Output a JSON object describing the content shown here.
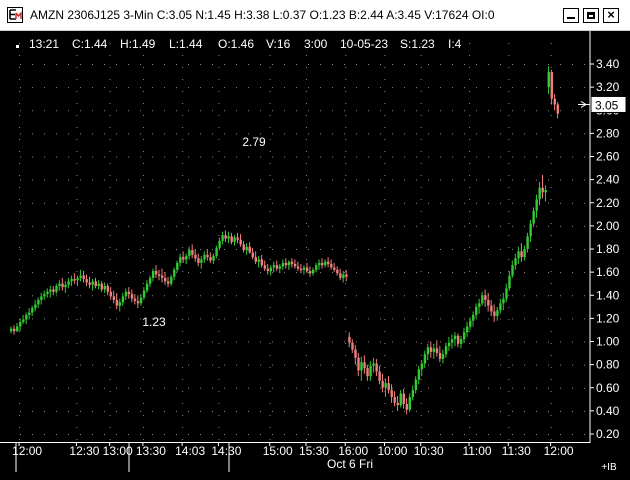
{
  "window": {
    "title": "AMZN 2306J125 3-Min C:3.05 N:1.45 H:3.38 L:0.37 O:1.23 B:2.44 A:3.45 V:17624 OI:0",
    "close_glyph": "×"
  },
  "info_bar": [
    "13:21",
    "C:1.44",
    "H:1.49",
    "L:1.44",
    "O:1.46",
    "V:16",
    "3:00",
    "10-05-23",
    "S:1.23",
    "I:4"
  ],
  "annotations": {
    "high_label": "2.79",
    "low_label": "1.23"
  },
  "colors": {
    "up": "#33cc33",
    "down": "#f08080",
    "background": "#000000",
    "text": "#ffffff",
    "grid_dot": "#8a8a8a"
  },
  "chart_data": {
    "type": "candlestick",
    "symbol": "AMZN 2306J125",
    "interval": "3-Min",
    "current_price_label": "3.05",
    "current_price": 3.05,
    "ylim": [
      0.18,
      3.52
    ],
    "y_ticks": [
      "3.40",
      "3.20",
      "3.00",
      "2.80",
      "2.60",
      "2.40",
      "2.20",
      "2.00",
      "1.80",
      "1.60",
      "1.40",
      "1.20",
      "1.00",
      "0.80",
      "0.60",
      "0.40",
      "0.20"
    ],
    "x_ticks": [
      "12:00",
      "12:30",
      "13:00",
      "13:30",
      "14:03",
      "14:30",
      "15:00",
      "15:30",
      "16:00",
      "10:00",
      "10:30",
      "11:00",
      "11:30",
      "12:00"
    ],
    "x_ticks_bar_index": [
      3,
      22,
      33,
      44,
      57,
      69,
      86,
      98,
      111,
      124,
      136,
      152,
      165,
      179
    ],
    "session_label": "Oct 6 Fri",
    "corner_label": "+IB",
    "ohlc": [
      [
        1.09,
        1.13,
        1.07,
        1.11
      ],
      [
        1.11,
        1.14,
        1.06,
        1.09
      ],
      [
        1.09,
        1.16,
        1.08,
        1.13
      ],
      [
        1.13,
        1.19,
        1.09,
        1.17
      ],
      [
        1.17,
        1.23,
        1.15,
        1.19
      ],
      [
        1.19,
        1.25,
        1.15,
        1.23
      ],
      [
        1.23,
        1.29,
        1.19,
        1.25
      ],
      [
        1.25,
        1.31,
        1.22,
        1.29
      ],
      [
        1.29,
        1.36,
        1.26,
        1.32
      ],
      [
        1.32,
        1.38,
        1.29,
        1.36
      ],
      [
        1.36,
        1.42,
        1.32,
        1.39
      ],
      [
        1.39,
        1.44,
        1.36,
        1.41
      ],
      [
        1.41,
        1.46,
        1.38,
        1.43
      ],
      [
        1.43,
        1.48,
        1.38,
        1.45
      ],
      [
        1.45,
        1.48,
        1.4,
        1.43
      ],
      [
        1.43,
        1.5,
        1.41,
        1.48
      ],
      [
        1.48,
        1.53,
        1.44,
        1.5
      ],
      [
        1.5,
        1.55,
        1.44,
        1.47
      ],
      [
        1.47,
        1.52,
        1.42,
        1.49
      ],
      [
        1.49,
        1.55,
        1.46,
        1.52
      ],
      [
        1.52,
        1.57,
        1.48,
        1.54
      ],
      [
        1.54,
        1.59,
        1.5,
        1.53
      ],
      [
        1.53,
        1.57,
        1.48,
        1.55
      ],
      [
        1.55,
        1.62,
        1.52,
        1.57
      ],
      [
        1.57,
        1.61,
        1.51,
        1.54
      ],
      [
        1.54,
        1.58,
        1.48,
        1.51
      ],
      [
        1.51,
        1.56,
        1.46,
        1.49
      ],
      [
        1.49,
        1.54,
        1.44,
        1.52
      ],
      [
        1.52,
        1.55,
        1.46,
        1.48
      ],
      [
        1.48,
        1.53,
        1.45,
        1.5
      ],
      [
        1.5,
        1.52,
        1.43,
        1.45
      ],
      [
        1.45,
        1.51,
        1.42,
        1.48
      ],
      [
        1.48,
        1.5,
        1.4,
        1.43
      ],
      [
        1.43,
        1.47,
        1.36,
        1.39
      ],
      [
        1.39,
        1.44,
        1.33,
        1.36
      ],
      [
        1.36,
        1.42,
        1.28,
        1.31
      ],
      [
        1.31,
        1.37,
        1.26,
        1.34
      ],
      [
        1.34,
        1.42,
        1.31,
        1.39
      ],
      [
        1.39,
        1.46,
        1.36,
        1.43
      ],
      [
        1.43,
        1.47,
        1.37,
        1.41
      ],
      [
        1.41,
        1.45,
        1.34,
        1.37
      ],
      [
        1.37,
        1.41,
        1.32,
        1.35
      ],
      [
        1.35,
        1.4,
        1.29,
        1.33
      ],
      [
        1.33,
        1.41,
        1.31,
        1.38
      ],
      [
        1.38,
        1.47,
        1.36,
        1.44
      ],
      [
        1.44,
        1.53,
        1.42,
        1.5
      ],
      [
        1.5,
        1.57,
        1.47,
        1.55
      ],
      [
        1.55,
        1.63,
        1.52,
        1.61
      ],
      [
        1.61,
        1.66,
        1.55,
        1.58
      ],
      [
        1.58,
        1.62,
        1.53,
        1.57
      ],
      [
        1.57,
        1.63,
        1.51,
        1.55
      ],
      [
        1.55,
        1.6,
        1.49,
        1.52
      ],
      [
        1.52,
        1.56,
        1.47,
        1.5
      ],
      [
        1.5,
        1.58,
        1.48,
        1.56
      ],
      [
        1.56,
        1.64,
        1.53,
        1.62
      ],
      [
        1.62,
        1.7,
        1.6,
        1.68
      ],
      [
        1.68,
        1.76,
        1.65,
        1.73
      ],
      [
        1.73,
        1.78,
        1.68,
        1.71
      ],
      [
        1.71,
        1.76,
        1.67,
        1.74
      ],
      [
        1.74,
        1.82,
        1.71,
        1.79
      ],
      [
        1.79,
        1.84,
        1.72,
        1.75
      ],
      [
        1.75,
        1.8,
        1.69,
        1.72
      ],
      [
        1.72,
        1.76,
        1.65,
        1.68
      ],
      [
        1.68,
        1.74,
        1.63,
        1.71
      ],
      [
        1.71,
        1.78,
        1.68,
        1.75
      ],
      [
        1.75,
        1.8,
        1.7,
        1.73
      ],
      [
        1.73,
        1.77,
        1.68,
        1.7
      ],
      [
        1.7,
        1.76,
        1.67,
        1.74
      ],
      [
        1.74,
        1.83,
        1.72,
        1.81
      ],
      [
        1.81,
        1.9,
        1.79,
        1.87
      ],
      [
        1.87,
        1.95,
        1.84,
        1.92
      ],
      [
        1.92,
        1.96,
        1.86,
        1.89
      ],
      [
        1.89,
        1.95,
        1.85,
        1.91
      ],
      [
        1.91,
        1.94,
        1.84,
        1.86
      ],
      [
        1.86,
        1.92,
        1.83,
        1.9
      ],
      [
        1.9,
        1.94,
        1.85,
        1.88
      ],
      [
        1.88,
        1.93,
        1.82,
        1.84
      ],
      [
        1.84,
        1.87,
        1.77,
        1.79
      ],
      [
        1.79,
        1.85,
        1.75,
        1.82
      ],
      [
        1.82,
        1.86,
        1.76,
        1.77
      ],
      [
        1.77,
        1.81,
        1.71,
        1.73
      ],
      [
        1.73,
        1.78,
        1.67,
        1.69
      ],
      [
        1.69,
        1.74,
        1.64,
        1.71
      ],
      [
        1.71,
        1.75,
        1.64,
        1.66
      ],
      [
        1.66,
        1.7,
        1.61,
        1.63
      ],
      [
        1.63,
        1.67,
        1.58,
        1.61
      ],
      [
        1.61,
        1.66,
        1.57,
        1.64
      ],
      [
        1.64,
        1.69,
        1.6,
        1.66
      ],
      [
        1.66,
        1.7,
        1.61,
        1.63
      ],
      [
        1.63,
        1.67,
        1.59,
        1.65
      ],
      [
        1.65,
        1.71,
        1.62,
        1.68
      ],
      [
        1.68,
        1.72,
        1.63,
        1.66
      ],
      [
        1.66,
        1.7,
        1.62,
        1.69
      ],
      [
        1.69,
        1.72,
        1.64,
        1.67
      ],
      [
        1.67,
        1.71,
        1.63,
        1.65
      ],
      [
        1.65,
        1.69,
        1.61,
        1.63
      ],
      [
        1.63,
        1.67,
        1.59,
        1.62
      ],
      [
        1.62,
        1.66,
        1.58,
        1.64
      ],
      [
        1.64,
        1.68,
        1.59,
        1.61
      ],
      [
        1.61,
        1.65,
        1.56,
        1.59
      ],
      [
        1.59,
        1.64,
        1.57,
        1.62
      ],
      [
        1.62,
        1.68,
        1.6,
        1.66
      ],
      [
        1.66,
        1.71,
        1.62,
        1.68
      ],
      [
        1.68,
        1.72,
        1.63,
        1.66
      ],
      [
        1.66,
        1.71,
        1.64,
        1.69
      ],
      [
        1.69,
        1.73,
        1.64,
        1.67
      ],
      [
        1.67,
        1.71,
        1.62,
        1.64
      ],
      [
        1.64,
        1.68,
        1.6,
        1.62
      ],
      [
        1.62,
        1.65,
        1.57,
        1.59
      ],
      [
        1.59,
        1.63,
        1.53,
        1.55
      ],
      [
        1.55,
        1.61,
        1.51,
        1.58
      ],
      [
        1.58,
        1.62,
        1.52,
        1.56
      ],
      [
        1.04,
        1.08,
        0.95,
        0.99
      ],
      [
        0.99,
        1.02,
        0.9,
        0.93
      ],
      [
        0.93,
        0.97,
        0.8,
        0.86
      ],
      [
        0.86,
        0.9,
        0.7,
        0.75
      ],
      [
        0.75,
        0.87,
        0.66,
        0.82
      ],
      [
        0.82,
        0.88,
        0.72,
        0.77
      ],
      [
        0.77,
        0.8,
        0.66,
        0.7
      ],
      [
        0.7,
        0.83,
        0.66,
        0.79
      ],
      [
        0.79,
        0.86,
        0.73,
        0.81
      ],
      [
        0.81,
        0.85,
        0.7,
        0.74
      ],
      [
        0.74,
        0.79,
        0.63,
        0.66
      ],
      [
        0.66,
        0.72,
        0.56,
        0.6
      ],
      [
        0.6,
        0.68,
        0.52,
        0.64
      ],
      [
        0.64,
        0.7,
        0.55,
        0.58
      ],
      [
        0.58,
        0.63,
        0.47,
        0.52
      ],
      [
        0.52,
        0.57,
        0.44,
        0.47
      ],
      [
        0.47,
        0.53,
        0.4,
        0.45
      ],
      [
        0.45,
        0.58,
        0.43,
        0.55
      ],
      [
        0.55,
        0.59,
        0.42,
        0.46
      ],
      [
        0.46,
        0.51,
        0.37,
        0.41
      ],
      [
        0.41,
        0.55,
        0.39,
        0.52
      ],
      [
        0.52,
        0.62,
        0.49,
        0.58
      ],
      [
        0.58,
        0.7,
        0.55,
        0.67
      ],
      [
        0.67,
        0.79,
        0.63,
        0.76
      ],
      [
        0.76,
        0.84,
        0.7,
        0.81
      ],
      [
        0.81,
        0.92,
        0.77,
        0.89
      ],
      [
        0.89,
        0.98,
        0.84,
        0.95
      ],
      [
        0.95,
        1.0,
        0.86,
        0.91
      ],
      [
        0.91,
        0.98,
        0.85,
        0.94
      ],
      [
        0.94,
        1.01,
        0.87,
        0.9
      ],
      [
        0.9,
        0.96,
        0.82,
        0.85
      ],
      [
        0.85,
        0.93,
        0.81,
        0.89
      ],
      [
        0.89,
        0.99,
        0.86,
        0.96
      ],
      [
        0.96,
        1.04,
        0.92,
        0.99
      ],
      [
        0.99,
        1.06,
        0.94,
        1.02
      ],
      [
        1.02,
        1.08,
        0.96,
        1.05
      ],
      [
        1.05,
        1.07,
        0.95,
        0.98
      ],
      [
        0.98,
        1.05,
        0.94,
        1.02
      ],
      [
        1.02,
        1.12,
        0.99,
        1.08
      ],
      [
        1.08,
        1.17,
        1.04,
        1.13
      ],
      [
        1.13,
        1.21,
        1.1,
        1.18
      ],
      [
        1.18,
        1.26,
        1.13,
        1.23
      ],
      [
        1.23,
        1.33,
        1.2,
        1.3
      ],
      [
        1.3,
        1.37,
        1.24,
        1.33
      ],
      [
        1.33,
        1.43,
        1.31,
        1.4
      ],
      [
        1.4,
        1.45,
        1.3,
        1.36
      ],
      [
        1.36,
        1.42,
        1.26,
        1.31
      ],
      [
        1.31,
        1.36,
        1.22,
        1.26
      ],
      [
        1.26,
        1.32,
        1.17,
        1.22
      ],
      [
        1.22,
        1.3,
        1.18,
        1.27
      ],
      [
        1.27,
        1.37,
        1.24,
        1.33
      ],
      [
        1.33,
        1.42,
        1.27,
        1.37
      ],
      [
        1.37,
        1.5,
        1.34,
        1.46
      ],
      [
        1.46,
        1.61,
        1.44,
        1.57
      ],
      [
        1.57,
        1.7,
        1.55,
        1.66
      ],
      [
        1.66,
        1.76,
        1.62,
        1.72
      ],
      [
        1.72,
        1.82,
        1.67,
        1.78
      ],
      [
        1.78,
        1.85,
        1.69,
        1.73
      ],
      [
        1.73,
        1.83,
        1.7,
        1.8
      ],
      [
        1.8,
        1.94,
        1.77,
        1.91
      ],
      [
        1.91,
        2.05,
        1.86,
        2.02
      ],
      [
        2.02,
        2.16,
        1.99,
        2.13
      ],
      [
        2.13,
        2.27,
        2.07,
        2.23
      ],
      [
        2.23,
        2.38,
        2.18,
        2.33
      ],
      [
        2.33,
        2.44,
        2.24,
        2.29
      ],
      [
        2.29,
        2.35,
        2.21,
        2.31
      ],
      [
        3.2,
        3.38,
        3.14,
        3.33
      ],
      [
        3.33,
        3.35,
        3.05,
        3.1
      ],
      [
        3.1,
        3.14,
        3.0,
        3.05
      ],
      [
        3.05,
        3.07,
        2.93,
        2.97
      ]
    ]
  }
}
